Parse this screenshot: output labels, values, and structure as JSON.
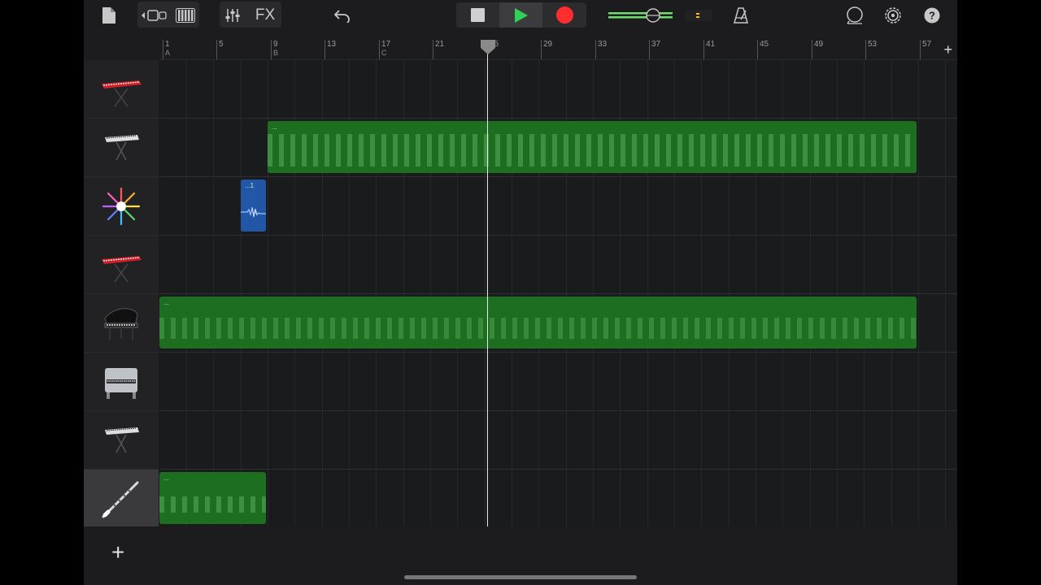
{
  "toolbar": {
    "fx_label": "FX",
    "icons": {
      "document": "document-icon",
      "view_toggle": "tracks-view-icon",
      "keyboard": "keyboard-icon",
      "mixer": "mixer-icon",
      "undo": "undo-icon",
      "stop": "stop-icon",
      "play": "play-icon",
      "record": "record-icon",
      "volume": "volume-slider",
      "metronome": "metronome-icon",
      "loops": "loop-icon",
      "settings": "gear-icon",
      "help": "help-icon"
    },
    "colors": {
      "play": "#2fd158",
      "record": "#ff2d2d",
      "volume": "#6fdc6f"
    }
  },
  "ruler": {
    "bars": [
      "1",
      "5",
      "9",
      "13",
      "17",
      "21",
      "25",
      "29",
      "33",
      "37",
      "41",
      "45",
      "49",
      "53",
      "57"
    ],
    "markers": {
      "1": "A",
      "9": "B",
      "17": "C"
    },
    "playhead_bar": "25"
  },
  "tracks": [
    {
      "instrument": "red-synth",
      "icon": "red-keyboard-icon"
    },
    {
      "instrument": "keyboard-stand",
      "icon": "keyboard-stand-icon"
    },
    {
      "instrument": "drummer-sampler",
      "icon": "sparkle-icon"
    },
    {
      "instrument": "red-synth",
      "icon": "red-keyboard-icon"
    },
    {
      "instrument": "grand-piano",
      "icon": "grand-piano-icon"
    },
    {
      "instrument": "electric-piano",
      "icon": "electric-piano-icon"
    },
    {
      "instrument": "keyboard-stand",
      "icon": "keyboard-stand-icon"
    },
    {
      "instrument": "clarinet",
      "icon": "clarinet-icon"
    }
  ],
  "regions": [
    {
      "label": "...",
      "type": "midi"
    },
    {
      "label": "...1",
      "type": "audio"
    },
    {
      "label": "...",
      "type": "midi"
    },
    {
      "label": "...",
      "type": "midi"
    }
  ],
  "colors": {
    "midi_region": "#1e6e21",
    "audio_region": "#2257a8"
  }
}
